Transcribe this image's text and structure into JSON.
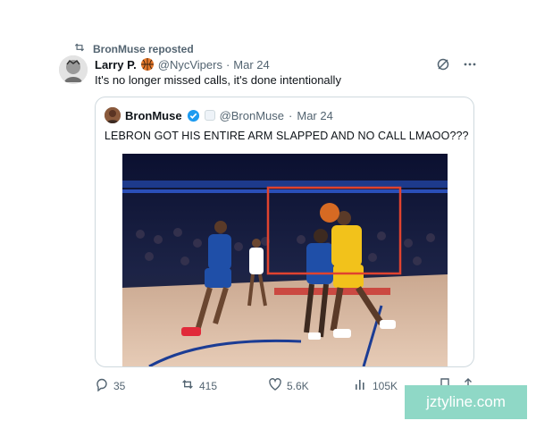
{
  "repost": {
    "label": "BronMuse reposted",
    "icon": "repost-icon"
  },
  "tweet": {
    "author_name": "Larry P.",
    "author_handle": "@NycVipers",
    "separator": "·",
    "date": "Mar 24",
    "text": "It's no longer missed calls, it's done intentionally",
    "badge_icon": "basketball-icon",
    "avatar_icon": "avatar-image"
  },
  "quote": {
    "author_name": "BronMuse",
    "author_handle": "@BronMuse",
    "separator": "·",
    "date": "Mar 24",
    "text": "LEBRON GOT HIS ENTIRE ARM SLAPPED AND NO CALL LMAOO???",
    "verified_icon": "verified-badge-icon"
  },
  "media": {
    "description_icon": "basketball-game-video-frame",
    "highlight_color": "#e0432f"
  },
  "actions": {
    "replies": "35",
    "reposts": "415",
    "likes": "5.6K",
    "views": "105K"
  },
  "watermark": {
    "text": "jztyline.com"
  },
  "colors": {
    "muted": "#536471",
    "border": "#cfd9de",
    "verified": "#1d9bf0",
    "watermark_bg": "#8fd8c6"
  }
}
